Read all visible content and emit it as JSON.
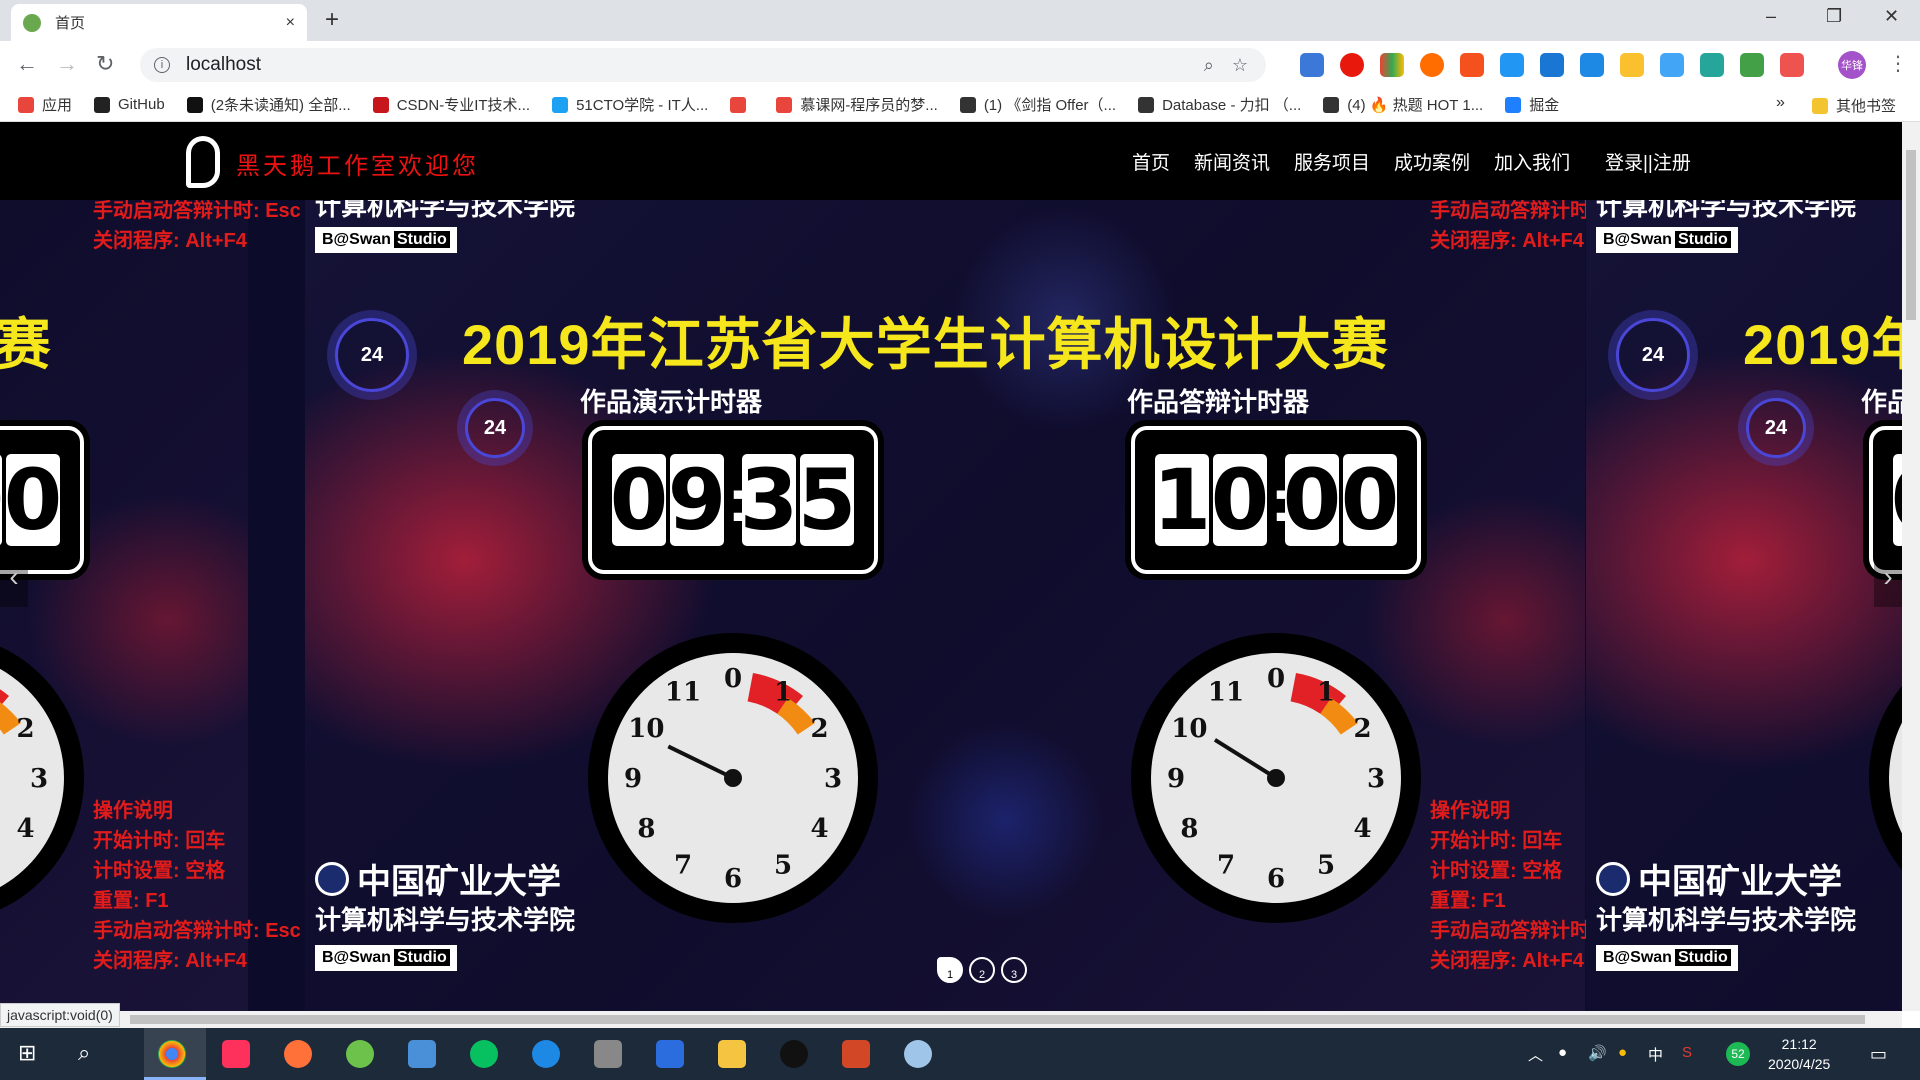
{
  "browser": {
    "tab_title": "首页",
    "tab_close": "×",
    "new_tab": "+",
    "url": "localhost",
    "win_minimize": "–",
    "win_restore": "❐",
    "win_close": "✕",
    "avatar_text": "华锋",
    "bookmarks_more": "»",
    "other_bookmarks": "其他书签",
    "bookmarks": [
      {
        "label": "应用",
        "color": "#e8453c"
      },
      {
        "label": "GitHub",
        "color": "#222222"
      },
      {
        "label": "(2条未读通知) 全部...",
        "color": "#111111"
      },
      {
        "label": "CSDN-专业IT技术...",
        "color": "#c8161d"
      },
      {
        "label": "51CTO学院 - IT人...",
        "color": "#1da1f2"
      },
      {
        "label": "",
        "color": "#e8453c"
      },
      {
        "label": "慕课网-程序员的梦...",
        "color": "#e8453c"
      },
      {
        "label": "(1) 《剑指 Offer（...",
        "color": "#333333"
      },
      {
        "label": "Database - 力扣 （...",
        "color": "#333333"
      },
      {
        "label": "(4) 🔥 热题 HOT 1...",
        "color": "#333333"
      },
      {
        "label": "掘金",
        "color": "#1e80ff"
      }
    ],
    "status_url": "javascript:void(0)"
  },
  "site": {
    "brand": "黑天鹅工作室欢迎您",
    "nav": [
      "首页",
      "新闻资讯",
      "服务项目",
      "成功案例",
      "加入我们"
    ],
    "login": "登录||注册"
  },
  "slide": {
    "title": "2019年江苏省大学生计算机设计大赛",
    "timer1_label": "作品演示计时器",
    "timer1_digits": [
      "0",
      "9",
      "3",
      "5"
    ],
    "timer2_label": "作品答辩计时器",
    "timer2_digits": [
      "1",
      "0",
      "0",
      "0"
    ],
    "info_title": "操作说明",
    "info_lines": [
      "开始计时: 回车",
      "计时设置: 空格",
      "重置: F1",
      "手动启动答辩计时: Esc",
      "关闭程序: Alt+F4"
    ],
    "univ": "中国矿业大学",
    "dept": "计算机科学与技术学院",
    "studio_a": "B@Swan",
    "studio_b": "Studio",
    "badge": "24",
    "clock_numbers": [
      "0",
      "1",
      "2",
      "3",
      "4",
      "5",
      "6",
      "7",
      "8",
      "9",
      "10",
      "11"
    ]
  },
  "carousel": {
    "prev": "‹",
    "next": "›",
    "dots": [
      "1",
      "2",
      "3"
    ],
    "active_dot": 1
  },
  "taskbar": {
    "time": "21:12",
    "date": "2020/4/25",
    "ime": "中",
    "badge_num": "52"
  },
  "colors": {
    "accent_red": "#e21b1b",
    "title_yellow": "#f6e61c"
  }
}
